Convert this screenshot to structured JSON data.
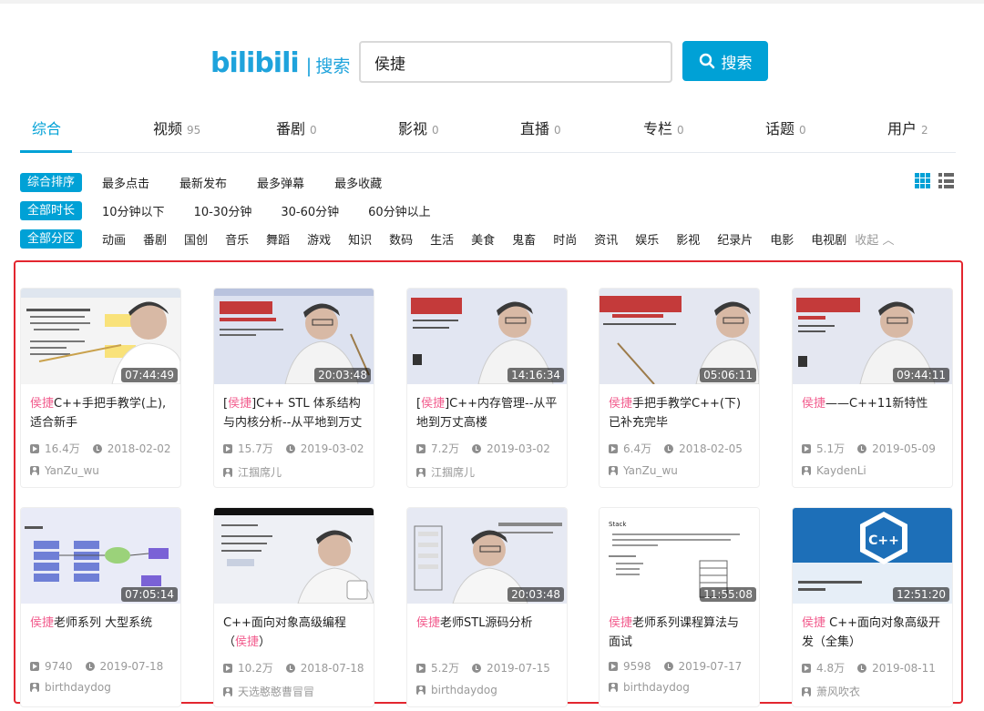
{
  "header": {
    "logo_mark": "bilibili",
    "logo_sep": "|",
    "logo_text": "搜索",
    "query": "侯捷",
    "search_button": "搜索",
    "accent_color": "#00a1d6"
  },
  "tabs": [
    {
      "label": "综合",
      "count": ""
    },
    {
      "label": "视频",
      "count": "95"
    },
    {
      "label": "番剧",
      "count": "0"
    },
    {
      "label": "影视",
      "count": "0"
    },
    {
      "label": "直播",
      "count": "0"
    },
    {
      "label": "专栏",
      "count": "0"
    },
    {
      "label": "话题",
      "count": "0"
    },
    {
      "label": "用户",
      "count": "2"
    }
  ],
  "filters": {
    "sort": {
      "active": "综合排序",
      "options": [
        "最多点击",
        "最新发布",
        "最多弹幕",
        "最多收藏"
      ]
    },
    "duration": {
      "active": "全部时长",
      "options": [
        "10分钟以下",
        "10-30分钟",
        "30-60分钟",
        "60分钟以上"
      ]
    },
    "category": {
      "active": "全部分区",
      "options": [
        "动画",
        "番剧",
        "国创",
        "音乐",
        "舞蹈",
        "游戏",
        "知识",
        "数码",
        "生活",
        "美食",
        "鬼畜",
        "时尚",
        "资讯",
        "娱乐",
        "影视",
        "纪录片",
        "电影",
        "电视剧"
      ],
      "collapse": "收起"
    },
    "view_icons": [
      "grid-view-icon",
      "list-view-icon"
    ]
  },
  "highlight_color": "#e3262f",
  "keyword_color": "#f25d8e",
  "videos": [
    {
      "duration": "07:44:49",
      "pre": "",
      "hl": "侯捷",
      "post": "C++手把手教学(上),适合新手",
      "views": "16.4万",
      "date": "2018-02-02",
      "uploader": "YanZu_wu",
      "slide_title": "",
      "slide_color": "#ffffff"
    },
    {
      "duration": "20:03:48",
      "pre": "[",
      "hl": "侯捷",
      "post": "]C++ STL 体系结构与内核分析--从平地到万丈高",
      "views": "15.7万",
      "date": "2019-03-02",
      "uploader": "江掴席儿",
      "slide_title": "C++標準庫",
      "slide_color": "#c43a3a"
    },
    {
      "duration": "14:16:34",
      "pre": "[",
      "hl": "侯捷",
      "post": "]C++内存管理--从平地到万丈高楼",
      "views": "7.2万",
      "date": "2019-03-02",
      "uploader": "江掴席儿",
      "slide_title": "内存管理",
      "slide_color": "#c43a3a"
    },
    {
      "duration": "05:06:11",
      "pre": "",
      "hl": "侯捷",
      "post": "手把手教学C++(下)已补充完毕",
      "views": "6.4万",
      "date": "2018-02-05",
      "uploader": "YanZu_wu",
      "slide_title": "C++程序設計(II)",
      "slide_color": "#c43a3a"
    },
    {
      "duration": "09:44:11",
      "pre": "",
      "hl": "侯捷",
      "post": "——C++11新特性",
      "views": "5.1万",
      "date": "2019-05-09",
      "uploader": "KaydenLi",
      "slide_title": "C++ 2.0 新特性",
      "slide_color": "#c43a3a"
    },
    {
      "duration": "07:05:14",
      "pre": "",
      "hl": "侯捷",
      "post": "老师系列 大型系统",
      "views": "9740",
      "date": "2019-07-18",
      "uploader": "birthdaydog",
      "slide_title": "异步通信",
      "slide_color": "#ffffff"
    },
    {
      "duration": "20:03:48",
      "pre": "C++面向对象高级编程（",
      "hl": "侯捷",
      "post": "）",
      "views": "10.2万",
      "date": "2018-07-18",
      "uploader": "天选憨憨曹冒冒",
      "slide_title": "",
      "slide_color": "#ffffff"
    },
    {
      "duration": "20:03:48",
      "pre": "",
      "hl": "侯捷",
      "post": "老师STL源码分析",
      "views": "5.2万",
      "date": "2019-07-15",
      "uploader": "birthdaydog",
      "slide_title": "",
      "slide_color": "#ffffff"
    },
    {
      "duration": "11:55:08",
      "pre": "",
      "hl": "侯捷",
      "post": "老师系列课程算法与面试",
      "views": "9598",
      "date": "2019-07-17",
      "uploader": "birthdaydog",
      "slide_title": "Stack",
      "slide_color": "#ffffff"
    },
    {
      "duration": "12:51:20",
      "pre": "",
      "hl": "侯捷",
      "post": " C++面向对象高级开发（全集）",
      "views": "4.8万",
      "date": "2019-08-11",
      "uploader": "萧风吹衣",
      "slide_title": "C++",
      "slide_color": "#1d6fb8"
    }
  ]
}
